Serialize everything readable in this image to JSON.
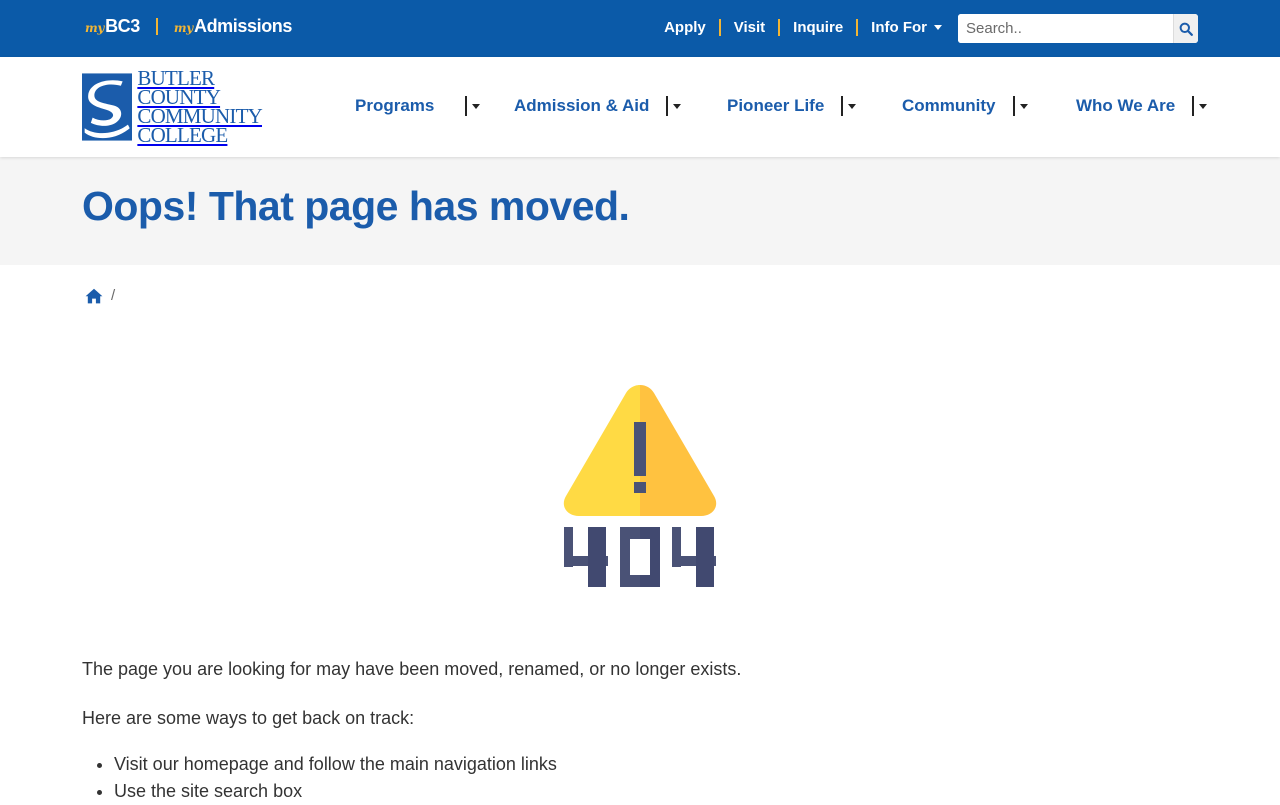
{
  "topbar": {
    "links": [
      {
        "prefix": "my",
        "name": "BC3"
      },
      {
        "prefix": "my",
        "name": "Admissions"
      }
    ],
    "util_nav": [
      "Apply",
      "Visit",
      "Inquire"
    ],
    "info_for": "Info For",
    "search_placeholder": "Search..",
    "colors": {
      "bar": "#0b5aa8",
      "accent": "#f2b534"
    }
  },
  "logo": {
    "lines": [
      "BUTLER",
      "COUNTY",
      "COMMUNITY",
      "COLLEGE"
    ]
  },
  "main_nav": [
    "Programs",
    "Admission & Aid",
    "Pioneer Life",
    "Community",
    "Who We Are"
  ],
  "page": {
    "title": "Oops! That page has moved.",
    "breadcrumb_sep": "/",
    "illustration": {
      "icon": "warning-triangle-404-icon",
      "label": "404"
    },
    "intro": "The page you are looking for may have been moved, renamed, or no longer exists.",
    "ways_heading": "Here are some ways to get back on track:",
    "ways": [
      "Visit our homepage and follow the main navigation links",
      "Use the site search box"
    ]
  }
}
